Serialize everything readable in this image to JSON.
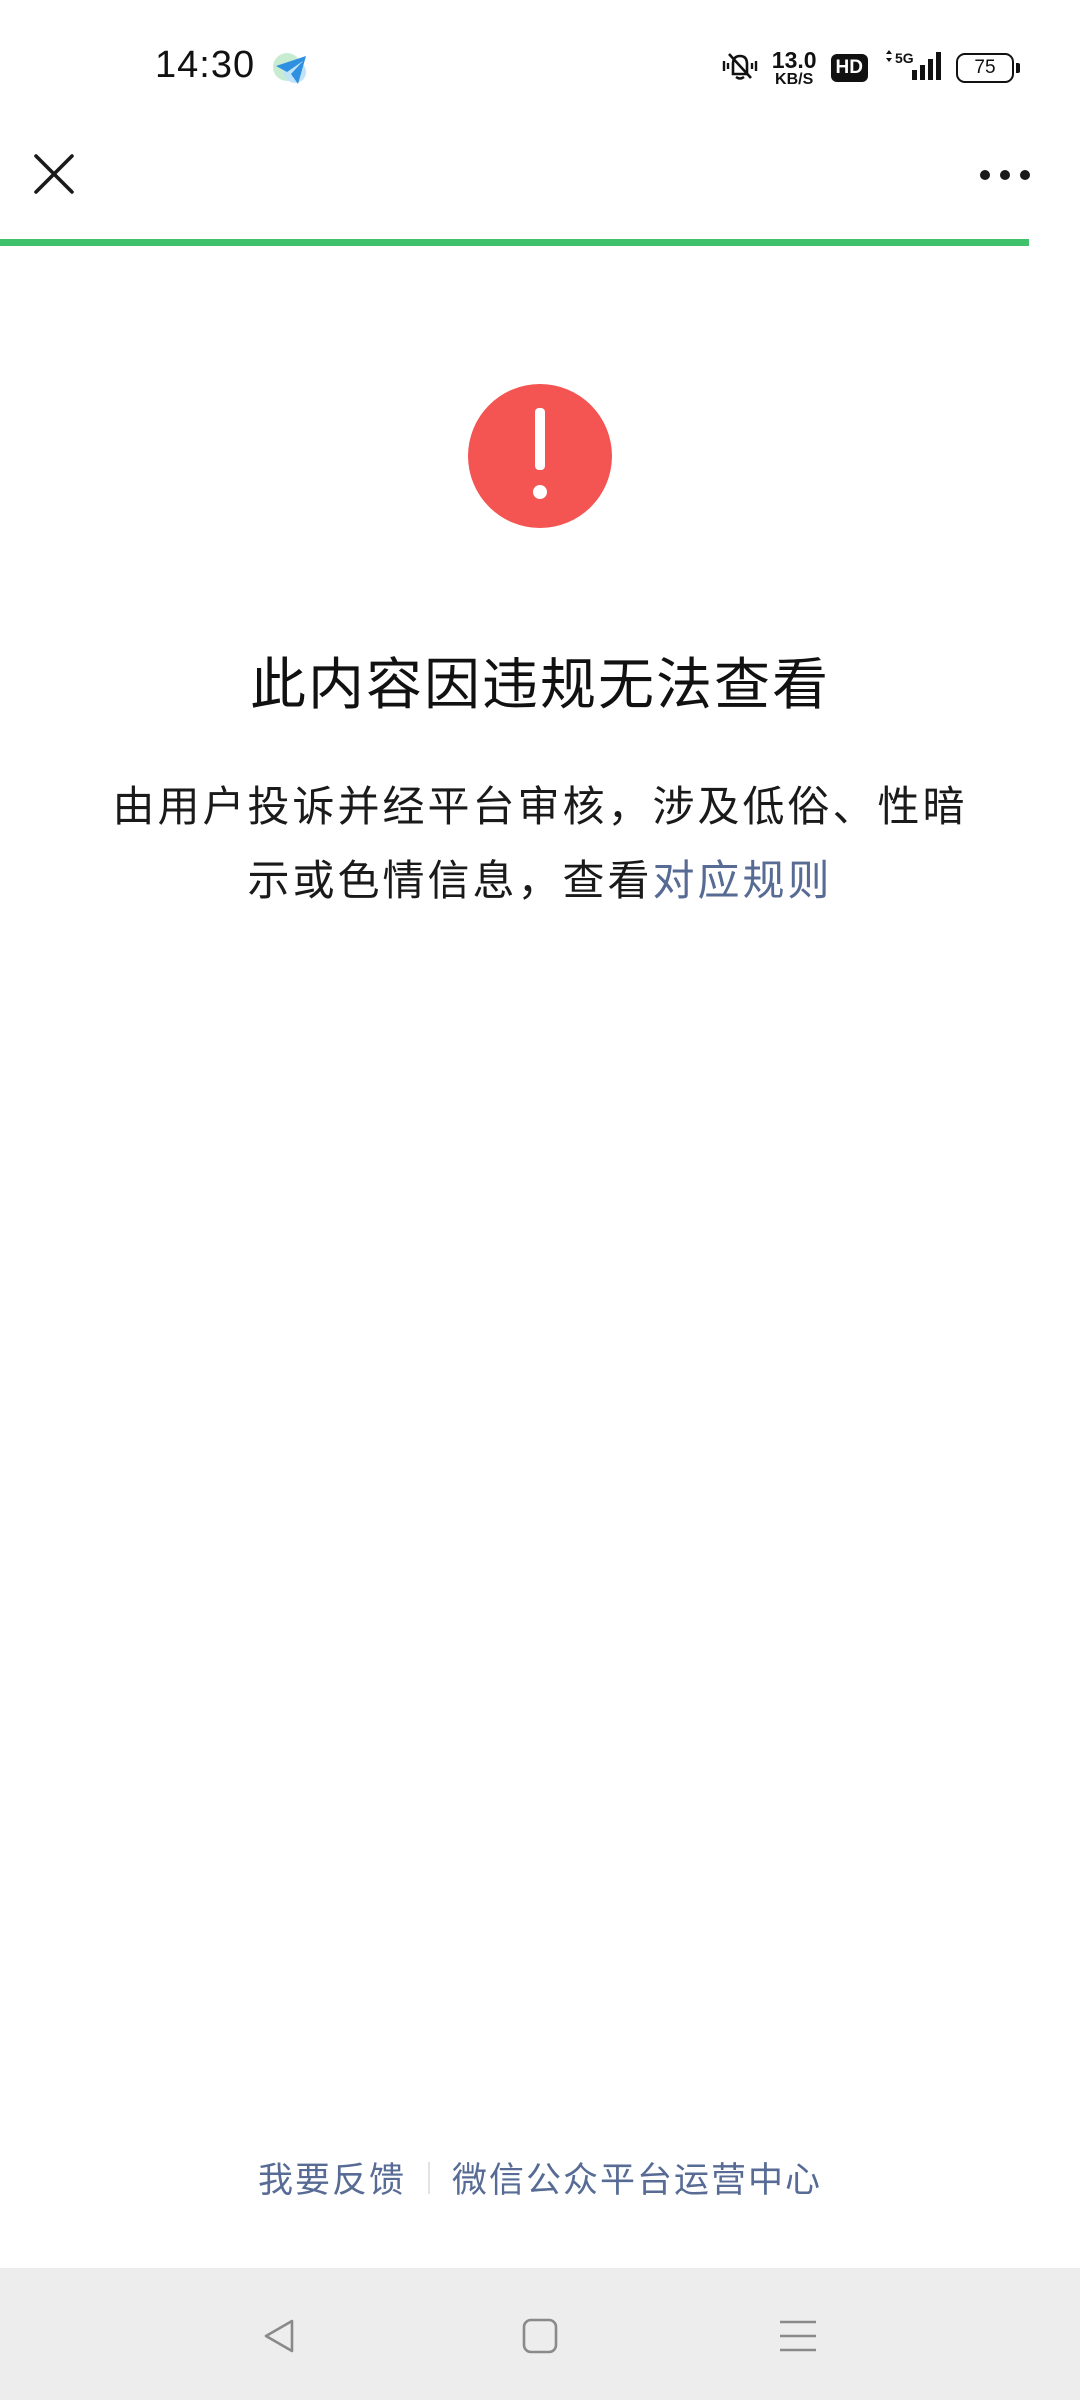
{
  "status_bar": {
    "time": "14:30",
    "app_icon": "telegram-like-send-icon",
    "mute_icon": "vibrate-silent-icon",
    "net_speed_value": "13.0",
    "net_speed_unit": "KB/S",
    "hd_label": "HD",
    "signal_label": "5G",
    "battery_level": "75"
  },
  "top_nav": {
    "close_icon": "close-icon",
    "more_icon": "more-dots-icon",
    "progress": 0.953,
    "progress_color": "#3fc26b"
  },
  "main": {
    "alert_icon": "exclamation-icon",
    "alert_color": "#f45452",
    "title": "此内容因违规无法查看",
    "description": "由用户投诉并经平台审核，涉及低俗、性暗示或色情信息，查看",
    "rule_link": "对应规则",
    "link_color": "#576b95"
  },
  "footer": {
    "feedback_link": "我要反馈",
    "platform_link": "微信公众平台运营中心"
  },
  "system_nav": {
    "back_icon": "back-triangle-icon",
    "home_icon": "home-square-icon",
    "menu_icon": "menu-lines-icon"
  }
}
